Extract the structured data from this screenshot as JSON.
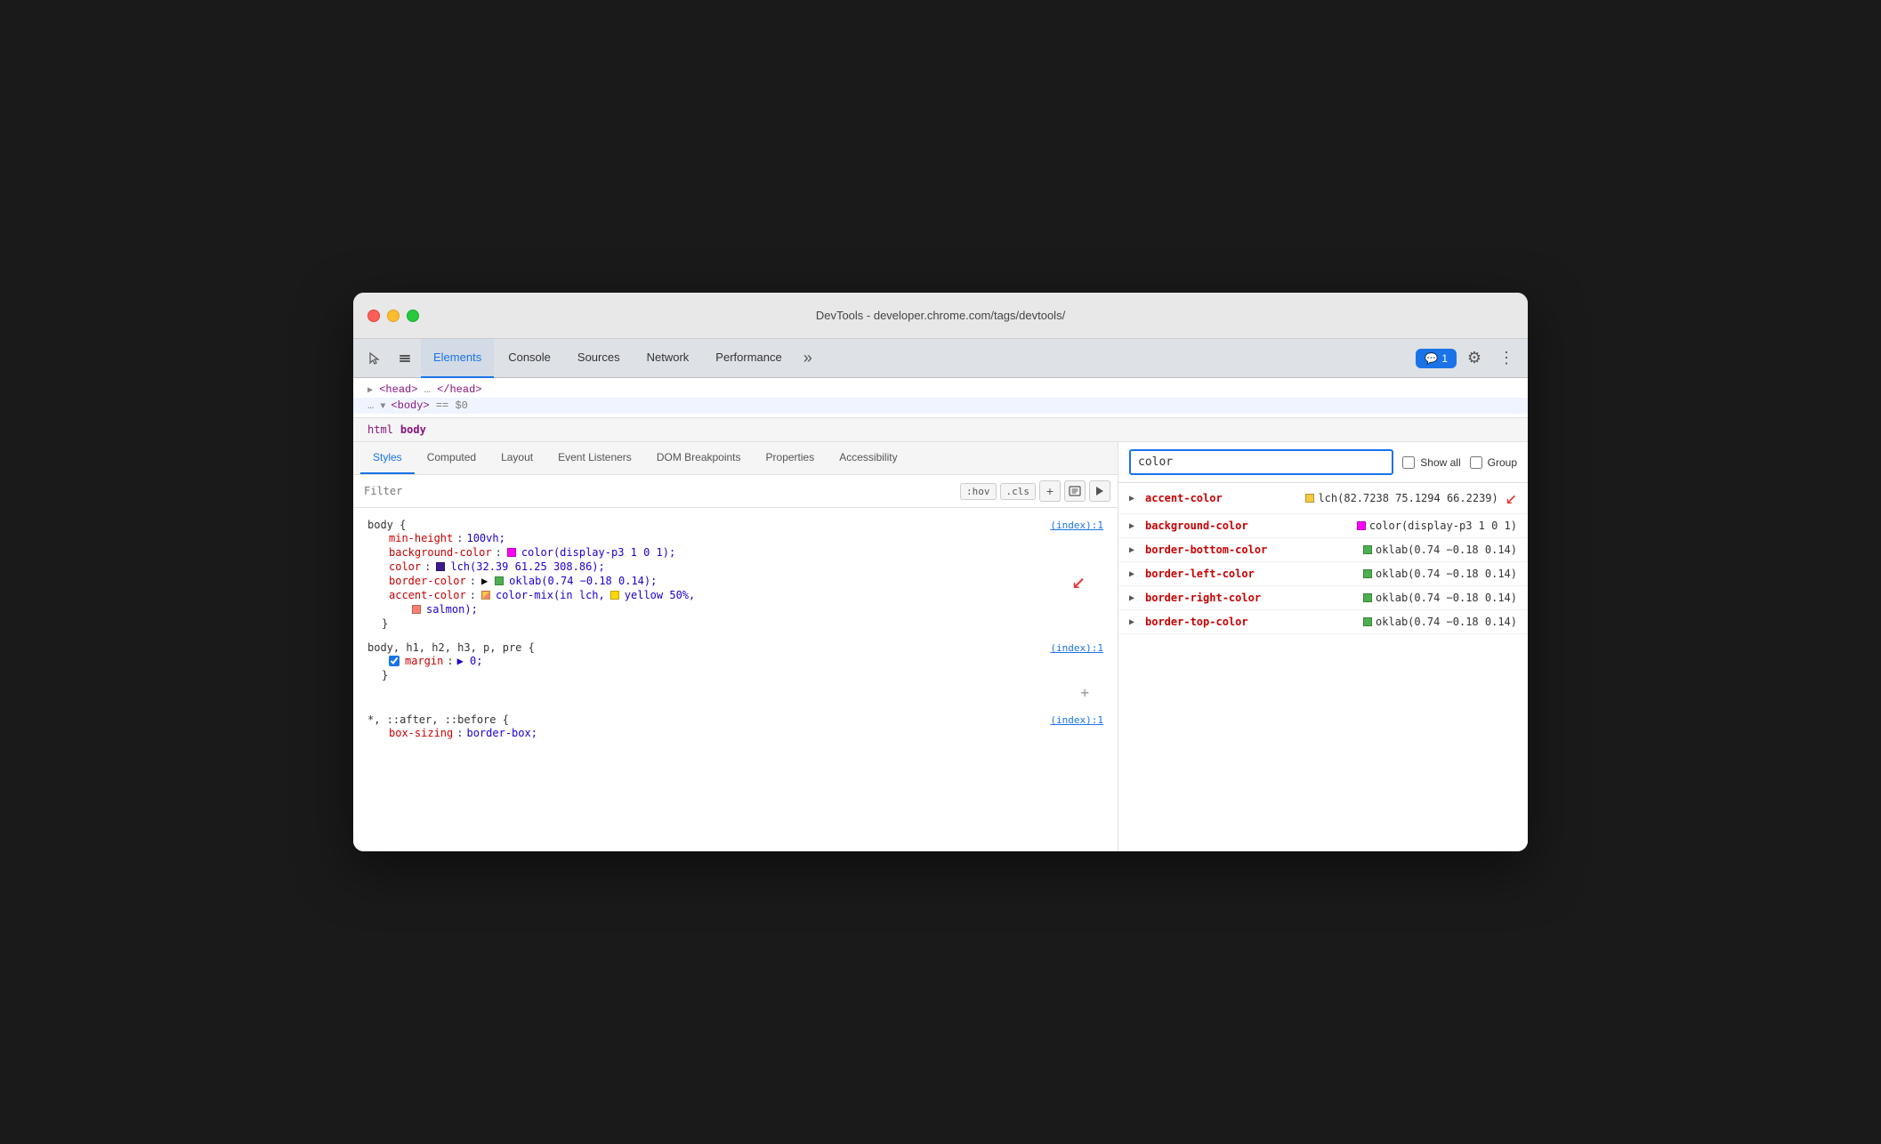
{
  "window": {
    "title": "DevTools - developer.chrome.com/tags/devtools/"
  },
  "traffic_lights": {
    "red": "close",
    "yellow": "minimize",
    "green": "maximize"
  },
  "top_tabs": {
    "icons": [
      "cursor",
      "layers"
    ],
    "tabs": [
      {
        "label": "Elements",
        "active": true
      },
      {
        "label": "Console",
        "active": false
      },
      {
        "label": "Sources",
        "active": false
      },
      {
        "label": "Network",
        "active": false
      },
      {
        "label": "Performance",
        "active": false
      }
    ],
    "more_label": "»",
    "badge": "1",
    "settings_icon": "⚙",
    "more_icon": "⋮"
  },
  "dom": {
    "head_line": "<head> … </head>",
    "body_line": "… ▼ <body> == $0"
  },
  "breadcrumb": {
    "html": "html",
    "body": "body"
  },
  "sub_tabs": [
    {
      "label": "Styles",
      "active": true
    },
    {
      "label": "Computed",
      "active": false
    },
    {
      "label": "Layout",
      "active": false
    },
    {
      "label": "Event Listeners",
      "active": false
    },
    {
      "label": "DOM Breakpoints",
      "active": false
    },
    {
      "label": "Properties",
      "active": false
    },
    {
      "label": "Accessibility",
      "active": false
    }
  ],
  "filter": {
    "placeholder": "Filter",
    "hov_label": ":hov",
    "cls_label": ".cls",
    "plus_icon": "+",
    "device_icon": "⊡",
    "play_icon": "▶"
  },
  "css_rules": [
    {
      "selector": "body {",
      "source": "(index):1",
      "properties": [
        {
          "name": "min-height",
          "colon": ":",
          "value": "100vh;",
          "swatch": null,
          "checked": null,
          "has_arrow": false
        },
        {
          "name": "background-color",
          "colon": ":",
          "value": "color(display-p3 1 0 1);",
          "swatch": "#ff00ff",
          "checked": null,
          "has_arrow": false
        },
        {
          "name": "color",
          "colon": ":",
          "value": "lch(32.39 61.25 308.86);",
          "swatch": "#3d1a8e",
          "checked": null,
          "has_arrow": false
        },
        {
          "name": "border-color",
          "colon": ":",
          "value": "oklab(0.74 −0.18 0.14);",
          "swatch": "#4caf50",
          "checked": null,
          "has_arrow": true
        },
        {
          "name": "accent-color",
          "colon": ":",
          "value": "color-mix(in lch,",
          "value2": "yellow 50%,",
          "value3": "salmon);",
          "swatch": "#f5c842",
          "swatch2": "#fa8072",
          "checked": null,
          "is_multiline": true,
          "has_arrow": false
        }
      ],
      "close": "}"
    },
    {
      "selector": "body, h1, h2, h3, p, pre {",
      "source": "(index):1",
      "properties": [
        {
          "name": "margin",
          "colon": ":",
          "value": "▶ 0;",
          "swatch": null,
          "checked": true,
          "has_arrow": false
        }
      ],
      "close": "}",
      "has_add": true
    },
    {
      "selector": "*, ::after, ::before {",
      "source": "(index):1",
      "properties": [
        {
          "name": "box-sizing",
          "colon": ":",
          "value": "border-box;",
          "swatch": null,
          "checked": null,
          "has_arrow": false
        }
      ],
      "is_partial": true
    }
  ],
  "right_panel": {
    "search_placeholder": "color",
    "show_all_label": "Show all",
    "group_label": "Group",
    "computed_items": [
      {
        "prop": "accent-color",
        "value": "lch(82.7238 75.1294 66.2239)",
        "swatch": "#f5c842",
        "has_arrow": true
      },
      {
        "prop": "background-color",
        "value": "color(display-p3 1 0 1)",
        "swatch": "#ff00ff",
        "has_arrow": false
      },
      {
        "prop": "border-bottom-color",
        "value": "oklab(0.74 −0.18 0.14)",
        "swatch": "#4caf50",
        "has_arrow": false
      },
      {
        "prop": "border-left-color",
        "value": "oklab(0.74 −0.18 0.14)",
        "swatch": "#4caf50",
        "has_arrow": false
      },
      {
        "prop": "border-right-color",
        "value": "oklab(0.74 −0.18 0.14)",
        "swatch": "#4caf50",
        "has_arrow": false
      },
      {
        "prop": "border-top-color",
        "value": "oklab(0.74 −0.18 0.14)",
        "swatch": "#4caf50",
        "has_arrow": false
      }
    ]
  }
}
